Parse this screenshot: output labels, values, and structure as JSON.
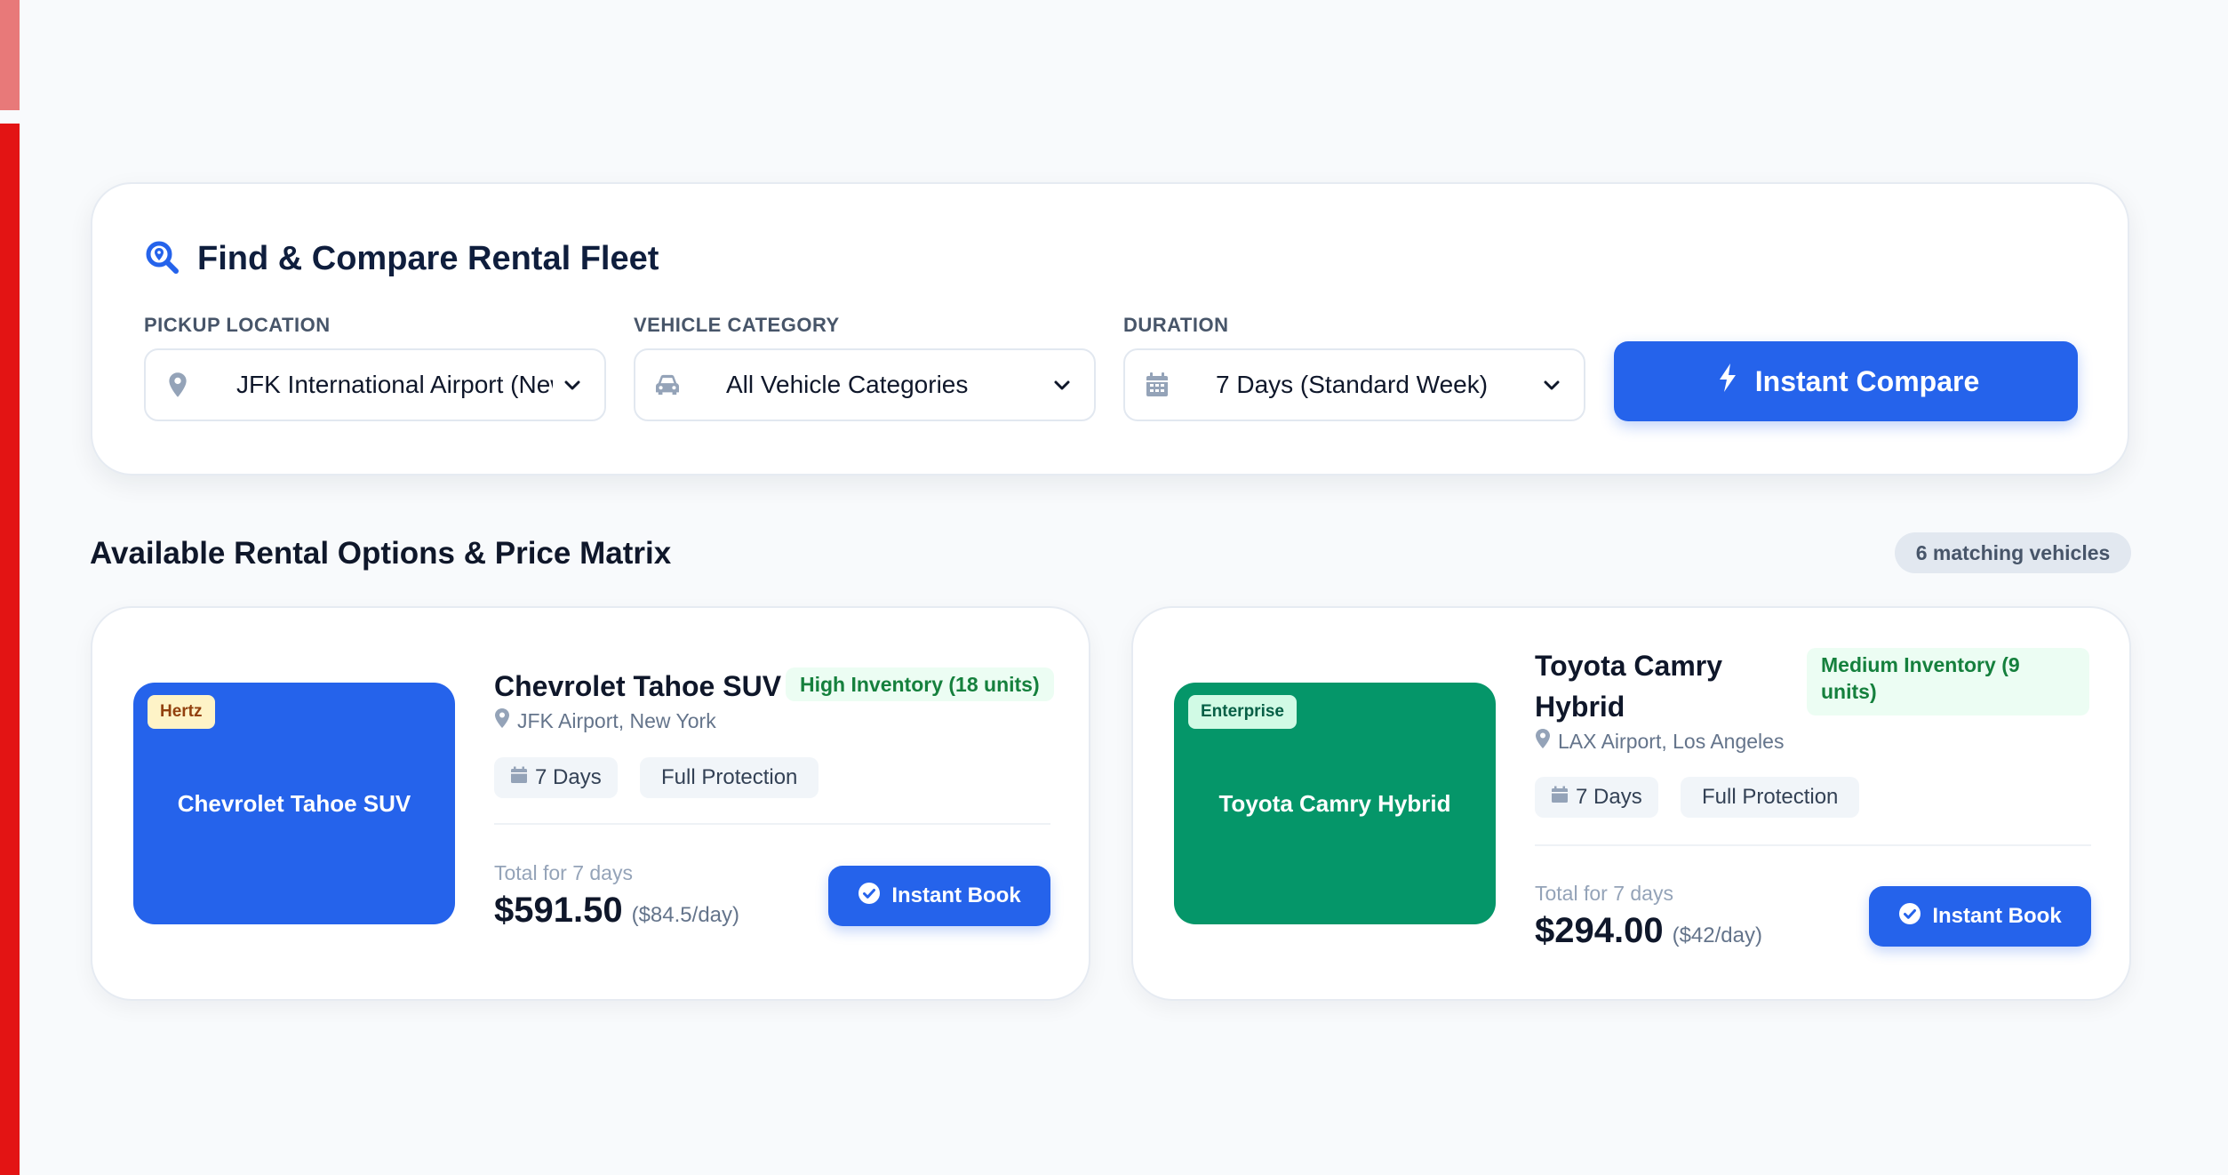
{
  "search": {
    "title": "Find & Compare Rental Fleet",
    "fields": {
      "pickup": {
        "label": "PICKUP LOCATION",
        "value": "JFK International Airport (New"
      },
      "category": {
        "label": "VEHICLE CATEGORY",
        "value": "All Vehicle Categories"
      },
      "duration": {
        "label": "DURATION",
        "value": "7 Days (Standard Week)"
      }
    },
    "button_label": "Instant Compare"
  },
  "results": {
    "title": "Available Rental Options & Price Matrix",
    "count_label": "6 matching vehicles",
    "vehicles": [
      {
        "brand": "Hertz",
        "thumb_label": "Chevrolet Tahoe SUV",
        "name": "Chevrolet Tahoe SUV",
        "inventory": "High Inventory (18 units)",
        "location": "JFK Airport, New York",
        "duration_chip": "7 Days",
        "protection_chip": "Full Protection",
        "total_label": "Total for 7 days",
        "price": "$591.50",
        "per_day": "($84.5/day)",
        "book_label": "Instant Book",
        "thumb_color": "#2563eb",
        "tag_bg": "#fef3c7",
        "tag_color": "#92400e"
      },
      {
        "brand": "Enterprise",
        "thumb_label": "Toyota Camry Hybrid",
        "name_line1": "Toyota Camry",
        "name_line2": "Hybrid",
        "inventory_line1": "Medium Inventory (9",
        "inventory_line2": "units)",
        "location": "LAX Airport, Los Angeles",
        "duration_chip": "7 Days",
        "protection_chip": "Full Protection",
        "total_label": "Total for 7 days",
        "price": "$294.00",
        "per_day": "($42/day)",
        "book_label": "Instant Book",
        "thumb_color": "#059669",
        "tag_bg": "#d1fae5",
        "tag_color": "#065f46"
      }
    ]
  },
  "colors": {
    "accent": "#2563eb",
    "rail_light": "#e87979",
    "rail_dark": "#e31414"
  },
  "icons": {
    "title": "search-location-icon",
    "pickup": "map-pin-icon",
    "category": "car-icon",
    "duration": "calendar-icon",
    "compare": "bolt-icon",
    "book": "check-circle-icon"
  }
}
